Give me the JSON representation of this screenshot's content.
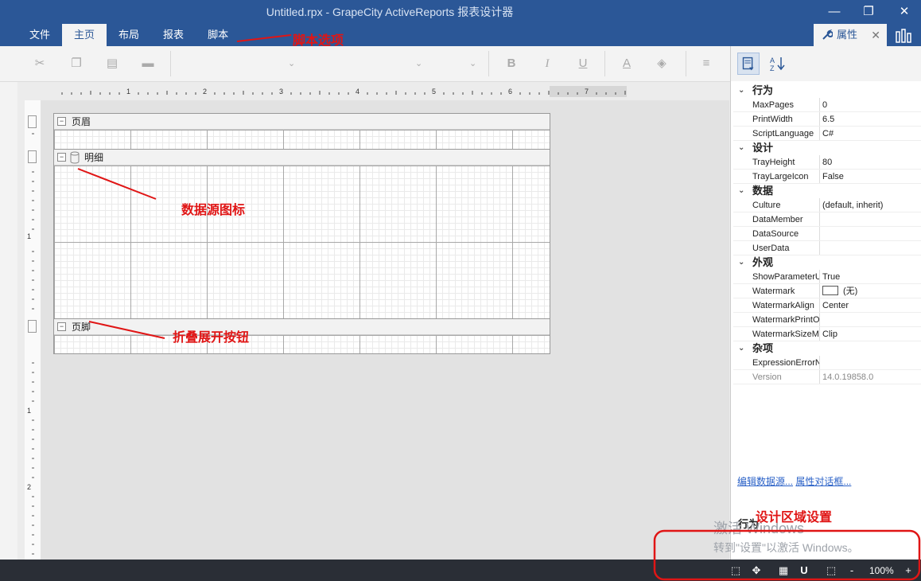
{
  "window": {
    "title": "Untitled.rpx - GrapeCity ActiveReports 报表设计器",
    "min_icon": "minimize-icon",
    "restore_icon": "restore-icon",
    "close_icon": "close-icon"
  },
  "menu": {
    "tabs": [
      "文件",
      "主页",
      "布局",
      "报表",
      "脚本"
    ],
    "active": "主页"
  },
  "props_tab": {
    "label": "属性"
  },
  "toolbar": {
    "icons": [
      "cut-icon",
      "copy-icon",
      "paste-icon",
      "delete-icon",
      "bold-icon",
      "italic-icon",
      "underline-icon",
      "font-color-icon",
      "fill-color-icon",
      "align-left-icon"
    ],
    "bold": "B",
    "italic": "I",
    "underline": "U",
    "fontcolor": "A"
  },
  "ruler": {
    "h_labels": [
      "1",
      "2",
      "3",
      "4",
      "5",
      "6",
      "7"
    ],
    "v_labels": [
      "1",
      "1",
      "2"
    ]
  },
  "report": {
    "bands": [
      {
        "label": "页眉",
        "toggle": "−"
      },
      {
        "label": "明细",
        "toggle": "−"
      },
      {
        "label": "页脚",
        "toggle": "−"
      }
    ]
  },
  "properties": {
    "categories": [
      {
        "name": "行为",
        "rows": [
          {
            "name": "MaxPages",
            "value": "0"
          },
          {
            "name": "PrintWidth",
            "value": "6.5"
          },
          {
            "name": "ScriptLanguage",
            "value": "C#"
          }
        ]
      },
      {
        "name": "设计",
        "rows": [
          {
            "name": "TrayHeight",
            "value": "80"
          },
          {
            "name": "TrayLargeIcon",
            "value": "False"
          }
        ]
      },
      {
        "name": "数据",
        "rows": [
          {
            "name": "Culture",
            "value": "(default, inherit)"
          },
          {
            "name": "DataMember",
            "value": ""
          },
          {
            "name": "DataSource",
            "value": ""
          },
          {
            "name": "UserData",
            "value": ""
          }
        ]
      },
      {
        "name": "外观",
        "rows": [
          {
            "name": "ShowParameterU",
            "value": "True"
          },
          {
            "name": "Watermark",
            "value": "(无)"
          },
          {
            "name": "WatermarkAlign",
            "value": "Center"
          },
          {
            "name": "WatermarkPrintO",
            "value": ""
          },
          {
            "name": "WatermarkSizeM",
            "value": "Clip"
          }
        ]
      },
      {
        "name": "杂项",
        "rows": [
          {
            "name": "ExpressionErrorN",
            "value": ""
          },
          {
            "name": "Version",
            "value": "14.0.19858.0"
          }
        ]
      }
    ],
    "link_datasource": "编辑数据源...",
    "link_dialog": "属性对话框...",
    "description_title": "行为"
  },
  "status": {
    "zoom": "100%",
    "zoom_out": "-",
    "zoom_in": "+"
  },
  "watermark": {
    "line1": "激活 Windows",
    "line2": "转到\"设置\"以激活 Windows。"
  },
  "annotations": {
    "script": "脚本选项",
    "datasource_icon": "数据源图标",
    "collapse": "折叠展开按钮",
    "design_area": "设计区域设置"
  },
  "colors": {
    "title_bar": "#2b5797",
    "status_bar": "#2a2e36",
    "annotation": "#e01515",
    "link": "#2a61c7"
  }
}
